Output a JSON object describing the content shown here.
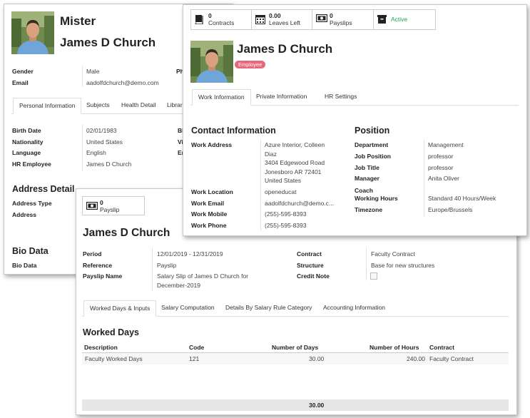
{
  "colors": {
    "badge": "#e8687b",
    "active_green": "#21a453",
    "footer_gray": "#e6e6e6"
  },
  "student": {
    "title": "Mister",
    "name": "James  D  Church",
    "fields": [
      {
        "label": "Gender",
        "value": "Male"
      },
      {
        "label": "Email",
        "value": "aadolfdchurch@demo.com"
      }
    ],
    "ph_label_fragment": "Ph",
    "tabs": [
      "Personal Information",
      "Subjects",
      "Health Detail",
      "Librar"
    ],
    "personal": [
      {
        "label": "Birth Date",
        "value": "02/01/1983"
      },
      {
        "label": "Nationality",
        "value": "United States"
      },
      {
        "label": "Language",
        "value": "English"
      },
      {
        "label": "HR Employee",
        "value": "James D Church"
      }
    ],
    "right_fragments": [
      "Bl",
      "Vi",
      "Er"
    ],
    "address_title": "Address Detail",
    "address_labels": [
      "Address Type",
      "Address"
    ],
    "bio_title": "Bio Data",
    "bio_label": "Bio Data"
  },
  "employee": {
    "stats": [
      {
        "icon": "book-icon",
        "num": "0",
        "text": "Contracts"
      },
      {
        "icon": "calendar-icon",
        "num": "0.00",
        "text": "Leaves Left"
      },
      {
        "icon": "money-icon",
        "num": "0",
        "text": "Payslips"
      },
      {
        "icon": "archive-icon",
        "num": "",
        "text": "Active"
      }
    ],
    "name": "James D Church",
    "badge": "Employee",
    "tabs": [
      "Work Information",
      "Private Information",
      "HR Settings"
    ],
    "contact_title": "Contact Information",
    "contact": [
      {
        "label": "Work Address",
        "lines": [
          "Azure Interior, Colleen",
          "Diaz",
          "3404 Edgewood Road",
          "Jonesboro AR 72401",
          "United States"
        ]
      },
      {
        "label": "Work Location",
        "lines": [
          "openeducat"
        ]
      },
      {
        "label": "Work Email",
        "lines": [
          "aadolfdchurch@demo.c..."
        ]
      },
      {
        "label": "Work Mobile",
        "lines": [
          "(255)-595-8393"
        ]
      },
      {
        "label": "Work Phone",
        "lines": [
          "(255)-595-8393"
        ]
      }
    ],
    "position_title": "Position",
    "position": [
      {
        "label": "Department",
        "value": "Management"
      },
      {
        "label": "Job Position",
        "value": "professor"
      },
      {
        "label": "Job Title",
        "value": "professor"
      },
      {
        "label": "Manager",
        "value": "Anita Oliver"
      },
      {
        "label": "Coach",
        "value": ""
      },
      {
        "label": "Working Hours",
        "value": "Standard 40 Hours/Week"
      },
      {
        "label": "Timezone",
        "value": "Europe/Brussels"
      }
    ]
  },
  "payslip": {
    "stat": {
      "num": "0",
      "text": "Payslip"
    },
    "name": "James D Church",
    "left": [
      {
        "label": "Period",
        "lines": [
          "12/01/2019 - 12/31/2019"
        ]
      },
      {
        "label": "Reference",
        "lines": [
          "Payslip"
        ]
      },
      {
        "label": "Payslip Name",
        "lines": [
          "Salary Slip of James D Church for",
          "December-2019"
        ]
      }
    ],
    "right": [
      {
        "label": "Contract",
        "value": "Faculty Contract"
      },
      {
        "label": "Structure",
        "value": "Base for new structures"
      },
      {
        "label": "Credit Note",
        "value": ""
      }
    ],
    "tabs": [
      "Worked Days & Inputs",
      "Salary Computation",
      "Details By Salary Rule Category",
      "Accounting Information"
    ],
    "section_title": "Worked Days",
    "columns": [
      "Description",
      "Code",
      "Number of Days",
      "Number of Hours",
      "Contract"
    ],
    "rows": [
      {
        "description": "Faculty Worked Days",
        "code": "121",
        "days": "30.00",
        "hours": "240.00",
        "contract": "Faculty Contract"
      }
    ],
    "footer_total": "30.00"
  }
}
